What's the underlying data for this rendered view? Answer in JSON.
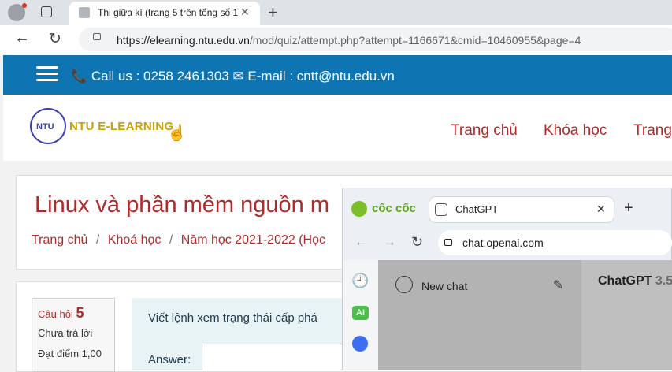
{
  "browser": {
    "tab_title": "Thi giữa kì (trang 5 trên tổng số 1",
    "close_glyph": "✕",
    "new_tab_glyph": "+",
    "url_host": "https://elearning.ntu.edu.vn",
    "url_path": "/mod/quiz/attempt.php?attempt=1166671&cmid=10460955&page=4"
  },
  "site": {
    "contact": "📞 Call us : 0258 2461303 ✉ E-mail : cntt@ntu.edu.vn",
    "logo_text": "NTU E-LEARNING",
    "logo_initials": "NTU",
    "nav": [
      "Trang chủ",
      "Khóa học",
      "Trang"
    ],
    "course_title": "Linux và phần mềm nguồn m",
    "breadcrumb": [
      "Trang chủ",
      "Khoá học",
      "Năm học 2021-2022 (Học"
    ],
    "breadcrumb_sep": "/"
  },
  "question": {
    "label": "Câu hỏi",
    "number": "5",
    "status": "Chưa trả lời",
    "points": "Đạt điểm 1,00",
    "text": "Viết lệnh xem trạng thái cấp phá",
    "answer_label": "Answer:"
  },
  "overlay": {
    "brand": "cốc cốc",
    "tab_title": "ChatGPT",
    "url": "chat.openai.com",
    "ai_badge": "AI",
    "new_chat": "New chat",
    "model": "ChatGPT",
    "model_version": "3.5"
  },
  "colors": {
    "topbar": "#0e74b2",
    "accent_red": "#b2292a",
    "answer_bg": "#e7f3f5"
  }
}
